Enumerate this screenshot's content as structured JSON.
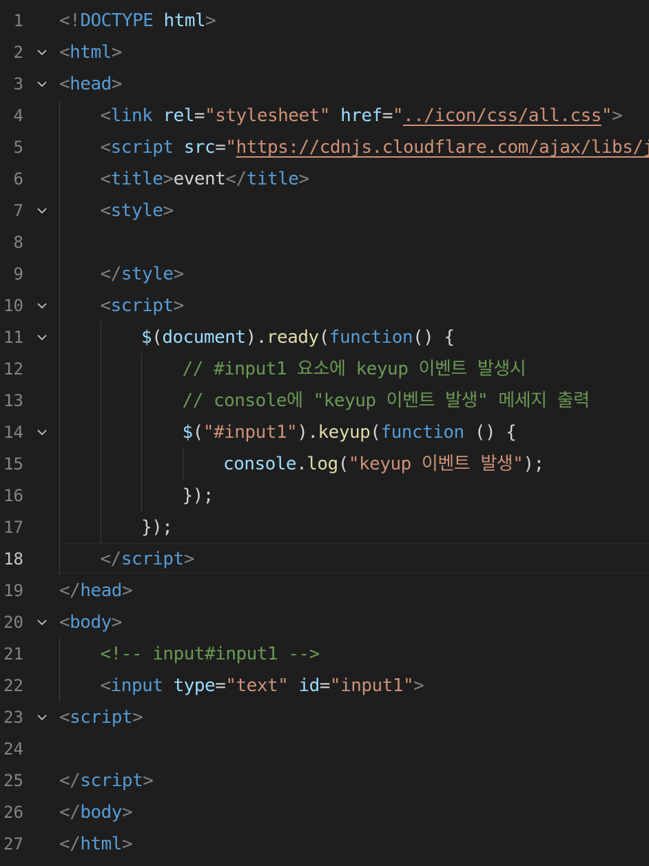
{
  "editor": {
    "theme_colors": {
      "background": "#1e1e1e",
      "line_number": "#858585",
      "tag": "#569cd6",
      "attribute": "#9cdcfe",
      "string": "#ce9178",
      "comment": "#6a9955",
      "function": "#dcdcaa"
    },
    "active_line": 18,
    "lines": [
      {
        "n": "1",
        "fold": false,
        "indent": 0,
        "tokens": [
          [
            "punc",
            "<!"
          ],
          [
            "tag",
            "DOCTYPE"
          ],
          [
            "plain",
            " "
          ],
          [
            "attr",
            "html"
          ],
          [
            "punc",
            ">"
          ]
        ]
      },
      {
        "n": "2",
        "fold": true,
        "indent": 0,
        "tokens": [
          [
            "punc",
            "<"
          ],
          [
            "tag",
            "html"
          ],
          [
            "punc",
            ">"
          ]
        ]
      },
      {
        "n": "3",
        "fold": true,
        "indent": 0,
        "tokens": [
          [
            "punc",
            "<"
          ],
          [
            "tag",
            "head"
          ],
          [
            "punc",
            ">"
          ]
        ]
      },
      {
        "n": "4",
        "fold": false,
        "indent": 1,
        "tokens": [
          [
            "punc",
            "<"
          ],
          [
            "tag",
            "link"
          ],
          [
            "plain",
            " "
          ],
          [
            "attr",
            "rel"
          ],
          [
            "plain",
            "="
          ],
          [
            "str",
            "\"stylesheet\""
          ],
          [
            "plain",
            " "
          ],
          [
            "attr",
            "href"
          ],
          [
            "plain",
            "="
          ],
          [
            "str",
            "\""
          ],
          [
            "link",
            "../icon/css/all.css"
          ],
          [
            "str",
            "\""
          ],
          [
            "punc",
            ">"
          ]
        ]
      },
      {
        "n": "5",
        "fold": false,
        "indent": 1,
        "tokens": [
          [
            "punc",
            "<"
          ],
          [
            "tag",
            "script"
          ],
          [
            "plain",
            " "
          ],
          [
            "attr",
            "src"
          ],
          [
            "plain",
            "="
          ],
          [
            "str",
            "\""
          ],
          [
            "link",
            "https://cdnjs.cloudflare.com/ajax/libs/jq"
          ]
        ]
      },
      {
        "n": "6",
        "fold": false,
        "indent": 1,
        "tokens": [
          [
            "punc",
            "<"
          ],
          [
            "tag",
            "title"
          ],
          [
            "punc",
            ">"
          ],
          [
            "text",
            "event"
          ],
          [
            "punc",
            "</"
          ],
          [
            "tag",
            "title"
          ],
          [
            "punc",
            ">"
          ]
        ]
      },
      {
        "n": "7",
        "fold": true,
        "indent": 1,
        "tokens": [
          [
            "punc",
            "<"
          ],
          [
            "tag",
            "style"
          ],
          [
            "punc",
            ">"
          ]
        ]
      },
      {
        "n": "8",
        "fold": false,
        "indent": 1,
        "tokens": []
      },
      {
        "n": "9",
        "fold": false,
        "indent": 1,
        "tokens": [
          [
            "punc",
            "</"
          ],
          [
            "tag",
            "style"
          ],
          [
            "punc",
            ">"
          ]
        ]
      },
      {
        "n": "10",
        "fold": true,
        "indent": 1,
        "tokens": [
          [
            "punc",
            "<"
          ],
          [
            "tag",
            "script"
          ],
          [
            "punc",
            ">"
          ]
        ]
      },
      {
        "n": "11",
        "fold": true,
        "indent": 2,
        "tokens": [
          [
            "fnv",
            "$"
          ],
          [
            "plain",
            "("
          ],
          [
            "var",
            "document"
          ],
          [
            "plain",
            ")."
          ],
          [
            "fn",
            "ready"
          ],
          [
            "plain",
            "("
          ],
          [
            "kw",
            "function"
          ],
          [
            "plain",
            "() {"
          ]
        ]
      },
      {
        "n": "12",
        "fold": false,
        "indent": 3,
        "tokens": [
          [
            "cmt",
            "// #input1 요소에 keyup 이벤트 발생시"
          ]
        ]
      },
      {
        "n": "13",
        "fold": false,
        "indent": 3,
        "tokens": [
          [
            "cmt",
            "// console에 \"keyup 이벤트 발생\" 메세지 출력"
          ]
        ]
      },
      {
        "n": "14",
        "fold": true,
        "indent": 3,
        "tokens": [
          [
            "fnv",
            "$"
          ],
          [
            "plain",
            "("
          ],
          [
            "str",
            "\"#input1\""
          ],
          [
            "plain",
            ")."
          ],
          [
            "fn",
            "keyup"
          ],
          [
            "plain",
            "("
          ],
          [
            "kw",
            "function"
          ],
          [
            "plain",
            " () {"
          ]
        ]
      },
      {
        "n": "15",
        "fold": false,
        "indent": 4,
        "tokens": [
          [
            "var",
            "console"
          ],
          [
            "plain",
            "."
          ],
          [
            "fn",
            "log"
          ],
          [
            "plain",
            "("
          ],
          [
            "str",
            "\"keyup 이벤트 발생\""
          ],
          [
            "plain",
            ");"
          ]
        ]
      },
      {
        "n": "16",
        "fold": false,
        "indent": 3,
        "tokens": [
          [
            "plain",
            "});"
          ]
        ]
      },
      {
        "n": "17",
        "fold": false,
        "indent": 2,
        "tokens": [
          [
            "plain",
            "});"
          ]
        ]
      },
      {
        "n": "18",
        "fold": false,
        "indent": 1,
        "tokens": [
          [
            "punc",
            "</"
          ],
          [
            "tag",
            "script"
          ],
          [
            "punc",
            ">"
          ]
        ]
      },
      {
        "n": "19",
        "fold": false,
        "indent": 0,
        "tokens": [
          [
            "punc",
            "</"
          ],
          [
            "tag",
            "head"
          ],
          [
            "punc",
            ">"
          ]
        ]
      },
      {
        "n": "20",
        "fold": true,
        "indent": 0,
        "tokens": [
          [
            "punc",
            "<"
          ],
          [
            "tag",
            "body"
          ],
          [
            "punc",
            ">"
          ]
        ]
      },
      {
        "n": "21",
        "fold": false,
        "indent": 1,
        "tokens": [
          [
            "cmt",
            "<!-- input#input1 -->"
          ]
        ]
      },
      {
        "n": "22",
        "fold": false,
        "indent": 1,
        "tokens": [
          [
            "punc",
            "<"
          ],
          [
            "tag",
            "input"
          ],
          [
            "plain",
            " "
          ],
          [
            "attr",
            "type"
          ],
          [
            "plain",
            "="
          ],
          [
            "str",
            "\"text\""
          ],
          [
            "plain",
            " "
          ],
          [
            "attr",
            "id"
          ],
          [
            "plain",
            "="
          ],
          [
            "str",
            "\"input1\""
          ],
          [
            "punc",
            ">"
          ]
        ]
      },
      {
        "n": "23",
        "fold": true,
        "indent": 0,
        "tokens": [
          [
            "punc",
            "<"
          ],
          [
            "tag",
            "script"
          ],
          [
            "punc",
            ">"
          ]
        ]
      },
      {
        "n": "24",
        "fold": false,
        "indent": 0,
        "tokens": []
      },
      {
        "n": "25",
        "fold": false,
        "indent": 0,
        "tokens": [
          [
            "punc",
            "</"
          ],
          [
            "tag",
            "script"
          ],
          [
            "punc",
            ">"
          ]
        ]
      },
      {
        "n": "26",
        "fold": false,
        "indent": 0,
        "tokens": [
          [
            "punc",
            "</"
          ],
          [
            "tag",
            "body"
          ],
          [
            "punc",
            ">"
          ]
        ]
      },
      {
        "n": "27",
        "fold": false,
        "indent": 0,
        "tokens": [
          [
            "punc",
            "</"
          ],
          [
            "tag",
            "html"
          ],
          [
            "punc",
            ">"
          ]
        ]
      }
    ]
  }
}
